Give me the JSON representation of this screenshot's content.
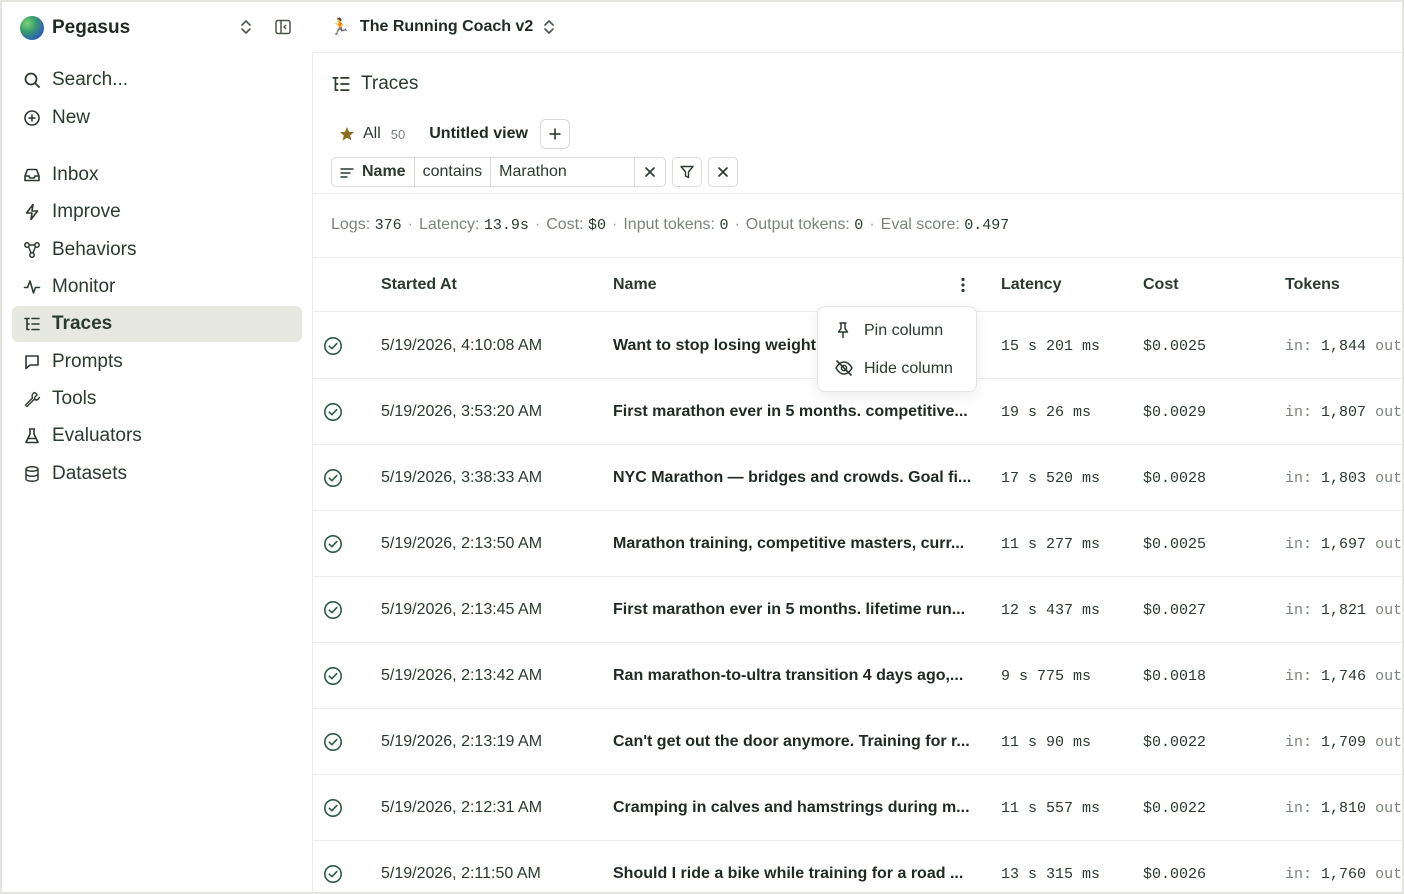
{
  "sidebar": {
    "org_name": "Pegasus",
    "search_label": "Search...",
    "new_label": "New",
    "items": [
      {
        "label": "Inbox",
        "icon": "inbox-icon"
      },
      {
        "label": "Improve",
        "icon": "bolt-icon"
      },
      {
        "label": "Behaviors",
        "icon": "behaviors-icon"
      },
      {
        "label": "Monitor",
        "icon": "pulse-icon"
      },
      {
        "label": "Traces",
        "icon": "traces-icon",
        "active": true
      },
      {
        "label": "Prompts",
        "icon": "message-icon"
      },
      {
        "label": "Tools",
        "icon": "wrench-icon"
      },
      {
        "label": "Evaluators",
        "icon": "flask-icon"
      },
      {
        "label": "Datasets",
        "icon": "database-icon"
      }
    ]
  },
  "header": {
    "project_emoji": "🏃",
    "project_name": "The Running Coach v2"
  },
  "traces": {
    "title": "Traces",
    "views": {
      "all_label": "All",
      "all_count": "50",
      "untitled_label": "Untitled view"
    },
    "filter": {
      "field": "Name",
      "operator": "contains",
      "value": "Marathon"
    },
    "summary": {
      "logs_label": "Logs:",
      "logs": "376",
      "latency_label": "Latency:",
      "latency": "13.9s",
      "cost_label": "Cost:",
      "cost": "$0",
      "input_label": "Input tokens:",
      "input": "0",
      "output_label": "Output tokens:",
      "output": "0",
      "eval_label": "Eval score:",
      "eval": "0.497"
    },
    "columns": {
      "started": "Started At",
      "name": "Name",
      "latency": "Latency",
      "cost": "Cost",
      "tokens": "Tokens"
    },
    "column_menu": {
      "pin": "Pin column",
      "hide": "Hide column"
    },
    "rows": [
      {
        "started": "5/19/2026, 4:10:08 AM",
        "name": "Want to stop losing weight",
        "latency": "15 s 201 ms",
        "cost": "$0.0025",
        "tokens_in": "1,844"
      },
      {
        "started": "5/19/2026, 3:53:20 AM",
        "name": "First marathon ever in 5 months. competitive...",
        "latency": "19 s 26 ms",
        "cost": "$0.0029",
        "tokens_in": "1,807"
      },
      {
        "started": "5/19/2026, 3:38:33 AM",
        "name": "NYC Marathon — bridges and crowds. Goal fi...",
        "latency": "17 s 520 ms",
        "cost": "$0.0028",
        "tokens_in": "1,803"
      },
      {
        "started": "5/19/2026, 2:13:50 AM",
        "name": "Marathon training, competitive masters, curr...",
        "latency": "11 s 277 ms",
        "cost": "$0.0025",
        "tokens_in": "1,697"
      },
      {
        "started": "5/19/2026, 2:13:45 AM",
        "name": "First marathon ever in 5 months. lifetime run...",
        "latency": "12 s 437 ms",
        "cost": "$0.0027",
        "tokens_in": "1,821"
      },
      {
        "started": "5/19/2026, 2:13:42 AM",
        "name": "Ran marathon-to-ultra transition 4 days ago,...",
        "latency": "9 s 775 ms",
        "cost": "$0.0018",
        "tokens_in": "1,746"
      },
      {
        "started": "5/19/2026, 2:13:19 AM",
        "name": "Can't get out the door anymore. Training for r...",
        "latency": "11 s 90 ms",
        "cost": "$0.0022",
        "tokens_in": "1,709"
      },
      {
        "started": "5/19/2026, 2:12:31 AM",
        "name": "Cramping in calves and hamstrings during m...",
        "latency": "11 s 557 ms",
        "cost": "$0.0022",
        "tokens_in": "1,810"
      },
      {
        "started": "5/19/2026, 2:11:50 AM",
        "name": "Should I ride a bike while training for a road ...",
        "latency": "13 s 315 ms",
        "cost": "$0.0026",
        "tokens_in": "1,760"
      }
    ],
    "tokens_in_label": "in:",
    "tokens_out_label": "out"
  },
  "colors": {
    "text": "#2b3a2e",
    "muted": "#7a847b",
    "active_bg": "#e7e8e2",
    "star": "#8a6d1f",
    "border": "#d9dad6"
  }
}
